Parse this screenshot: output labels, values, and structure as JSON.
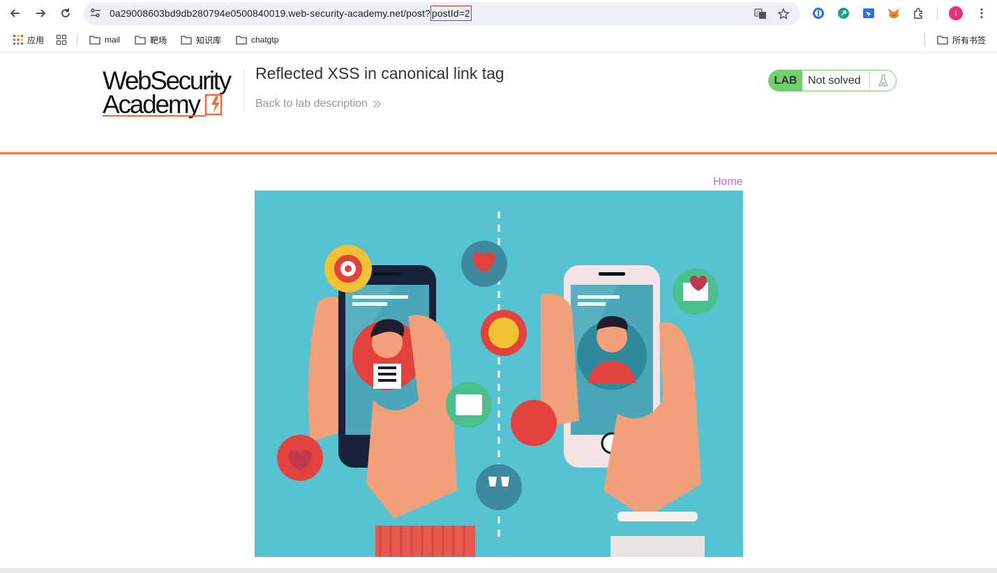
{
  "browser": {
    "url_base": "0a29008603bd9db280794e0500840019.web-security-academy.net/post?",
    "url_param": "postId=2",
    "profile_initial": "I"
  },
  "bookmarks": {
    "apps_label": "应用",
    "items": [
      {
        "label": "mail"
      },
      {
        "label": "靶场"
      },
      {
        "label": "知识库"
      },
      {
        "label": "chatgtp"
      }
    ],
    "all_bookmarks": "所有书签"
  },
  "header": {
    "logo_line1": "WebSecurity",
    "logo_line2": "Academy",
    "lab_title": "Reflected XSS in canonical link tag",
    "back_link": "Back to lab description",
    "status_tag": "LAB",
    "status_text": "Not solved"
  },
  "nav": {
    "home_label": "Home"
  },
  "colors": {
    "accent_orange": "#ff6633",
    "lab_green": "#70d16d",
    "link_purple": "#b66dcf",
    "image_bg": "#56c3d3"
  }
}
